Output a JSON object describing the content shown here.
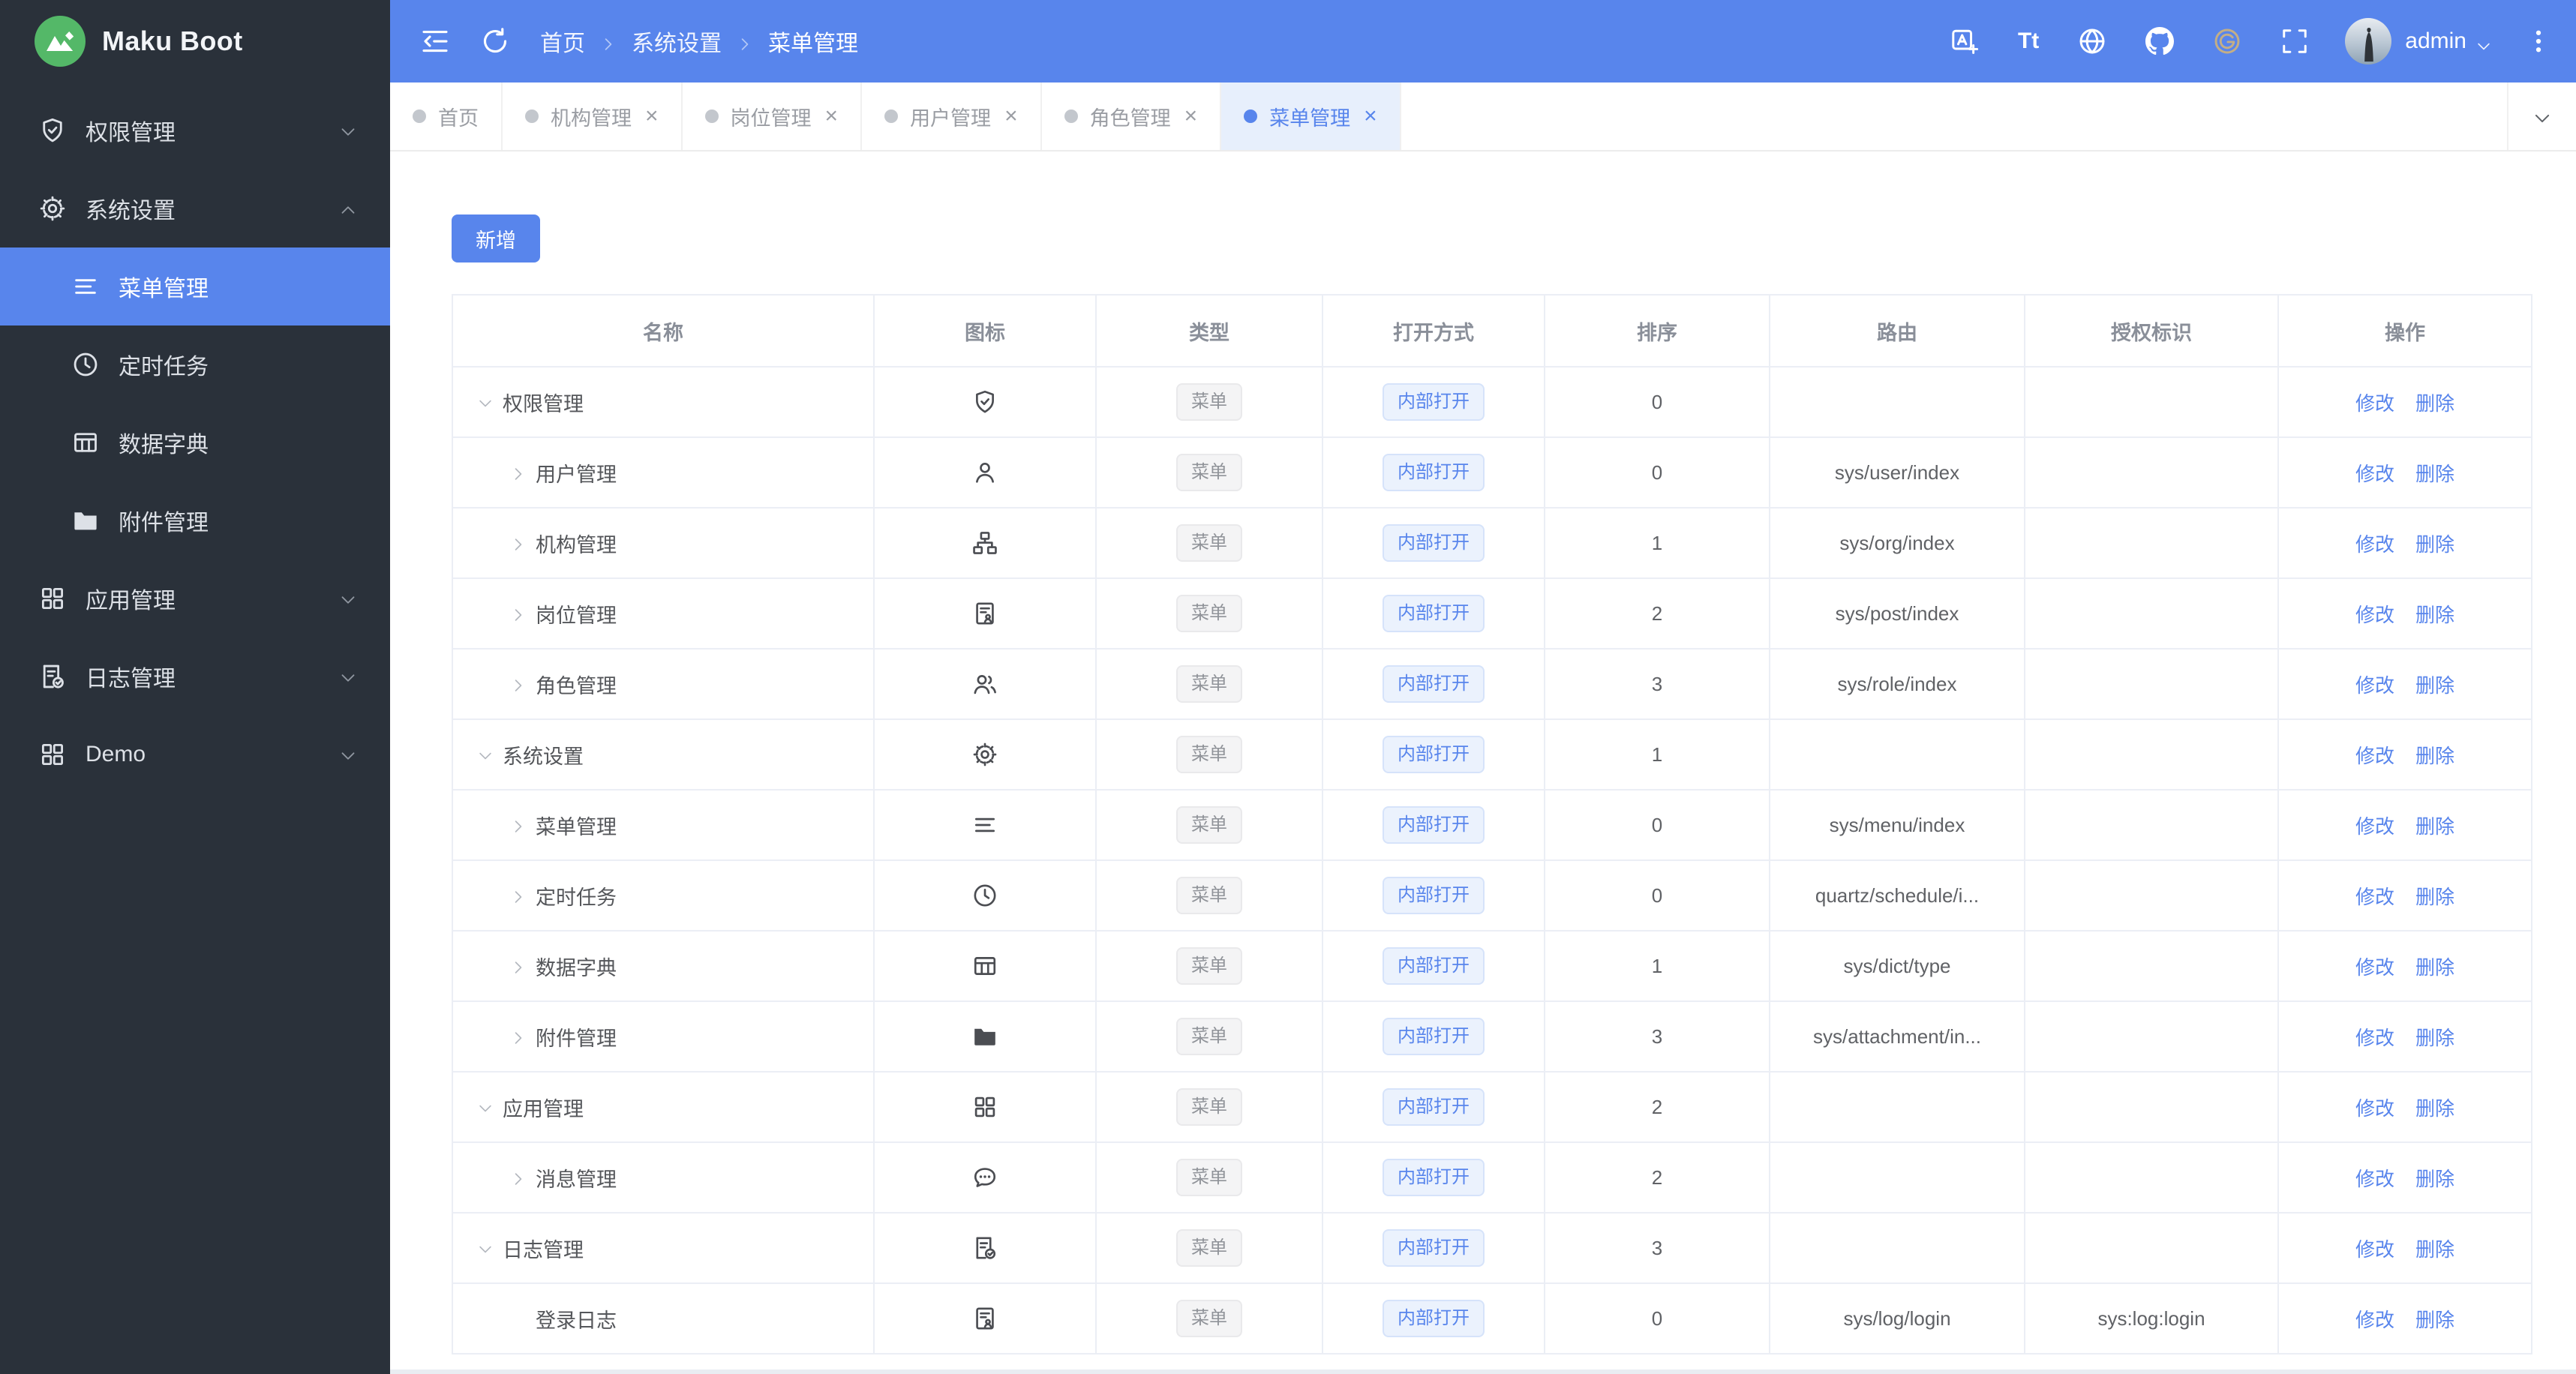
{
  "brand": {
    "name": "Maku Boot",
    "logo_icon": "mountain-logo",
    "logo_color": "#54b868"
  },
  "colors": {
    "primary": "#5885ec",
    "sidebar_bg": "#2a313a",
    "page_bg": "#e9edf2",
    "tab_active_bg": "#e7effc",
    "badge_gray_text": "#909399",
    "badge_blue_text": "#5885ec",
    "gitee_gold": "#c3ae86"
  },
  "header": {
    "left_icons": [
      "fold",
      "refresh"
    ],
    "breadcrumb": [
      "首页",
      "系统设置",
      "菜单管理"
    ],
    "right_icons": [
      "translate",
      "font-size",
      "globe",
      "github",
      "gitee",
      "fullscreen"
    ],
    "font_size_glyph": "Tt",
    "user": {
      "name": "admin",
      "avatar": "photo"
    },
    "more_icon": "kebab"
  },
  "sidebar": {
    "items": [
      {
        "label": "权限管理",
        "icon": "shield-check",
        "state": "collapsed"
      },
      {
        "label": "系统设置",
        "icon": "gear",
        "state": "expanded",
        "children": [
          {
            "label": "菜单管理",
            "icon": "menu-lines",
            "active": true
          },
          {
            "label": "定时任务",
            "icon": "clock"
          },
          {
            "label": "数据字典",
            "icon": "dict-table"
          },
          {
            "label": "附件管理",
            "icon": "folder"
          }
        ]
      },
      {
        "label": "应用管理",
        "icon": "grid",
        "state": "collapsed"
      },
      {
        "label": "日志管理",
        "icon": "log-doc",
        "state": "collapsed"
      },
      {
        "label": "Demo",
        "icon": "grid",
        "state": "collapsed"
      }
    ]
  },
  "tabs": [
    {
      "label": "首页",
      "closable": false,
      "active": false
    },
    {
      "label": "机构管理",
      "closable": true,
      "active": false
    },
    {
      "label": "岗位管理",
      "closable": true,
      "active": false
    },
    {
      "label": "用户管理",
      "closable": true,
      "active": false
    },
    {
      "label": "角色管理",
      "closable": true,
      "active": false
    },
    {
      "label": "菜单管理",
      "closable": true,
      "active": true
    }
  ],
  "toolbar": {
    "add_label": "新增"
  },
  "table": {
    "columns": [
      "名称",
      "图标",
      "类型",
      "打开方式",
      "排序",
      "路由",
      "授权标识",
      "操作"
    ],
    "type_badge": "菜单",
    "open_badge": "内部打开",
    "edit_label": "修改",
    "delete_label": "删除",
    "rows": [
      {
        "name": "权限管理",
        "level": 0,
        "caret": "down",
        "icon": "shield-check",
        "sort": "0",
        "route": "",
        "auth": ""
      },
      {
        "name": "用户管理",
        "level": 1,
        "caret": "right",
        "icon": "user",
        "sort": "0",
        "route": "sys/user/index",
        "auth": ""
      },
      {
        "name": "机构管理",
        "level": 1,
        "caret": "right",
        "icon": "org",
        "sort": "1",
        "route": "sys/org/index",
        "auth": ""
      },
      {
        "name": "岗位管理",
        "level": 1,
        "caret": "right",
        "icon": "post",
        "sort": "2",
        "route": "sys/post/index",
        "auth": ""
      },
      {
        "name": "角色管理",
        "level": 1,
        "caret": "right",
        "icon": "role",
        "sort": "3",
        "route": "sys/role/index",
        "auth": ""
      },
      {
        "name": "系统设置",
        "level": 0,
        "caret": "down",
        "icon": "gear",
        "sort": "1",
        "route": "",
        "auth": ""
      },
      {
        "name": "菜单管理",
        "level": 1,
        "caret": "right",
        "icon": "menu-lines",
        "sort": "0",
        "route": "sys/menu/index",
        "auth": ""
      },
      {
        "name": "定时任务",
        "level": 1,
        "caret": "right",
        "icon": "clock",
        "sort": "0",
        "route": "quartz/schedule/i...",
        "auth": ""
      },
      {
        "name": "数据字典",
        "level": 1,
        "caret": "right",
        "icon": "dict-table",
        "sort": "1",
        "route": "sys/dict/type",
        "auth": ""
      },
      {
        "name": "附件管理",
        "level": 1,
        "caret": "right",
        "icon": "folder",
        "sort": "3",
        "route": "sys/attachment/in...",
        "auth": ""
      },
      {
        "name": "应用管理",
        "level": 0,
        "caret": "down",
        "icon": "grid",
        "sort": "2",
        "route": "",
        "auth": ""
      },
      {
        "name": "消息管理",
        "level": 1,
        "caret": "right",
        "icon": "message",
        "sort": "2",
        "route": "",
        "auth": ""
      },
      {
        "name": "日志管理",
        "level": 0,
        "caret": "down",
        "icon": "log-doc",
        "sort": "3",
        "route": "",
        "auth": ""
      },
      {
        "name": "登录日志",
        "level": 1,
        "caret": "none",
        "icon": "post",
        "sort": "0",
        "route": "sys/log/login",
        "auth": "sys:log:login"
      }
    ]
  }
}
